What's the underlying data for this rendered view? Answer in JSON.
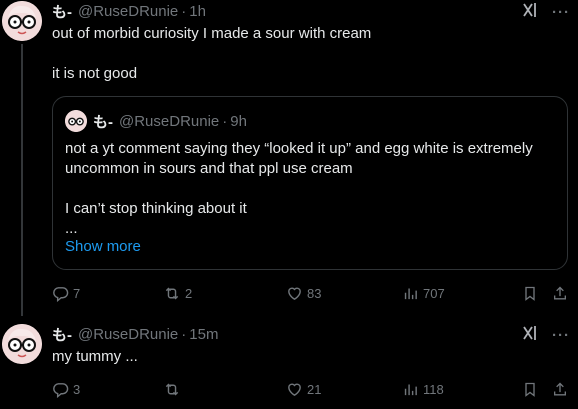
{
  "posts": [
    {
      "author_name": "も-",
      "handle": "@RuseDRunie",
      "separator": "·",
      "time": "1h",
      "text": "out of morbid curiosity I made a sour with cream\n\nit is not good",
      "quote": {
        "author_name": "も-",
        "handle": "@RuseDRunie",
        "separator": "·",
        "time": "9h",
        "text": "not a yt comment saying they “looked it up” and egg white is extremely uncommon in sours and that ppl use cream\n\nI can’t stop thinking about it\n...",
        "show_more": "Show more"
      },
      "stats": {
        "replies": "7",
        "reposts": "2",
        "likes": "83",
        "views": "707"
      }
    },
    {
      "author_name": "も-",
      "handle": "@RuseDRunie",
      "separator": "·",
      "time": "15m",
      "text": "my tummy ...",
      "stats": {
        "replies": "3",
        "reposts": "",
        "likes": "21",
        "views": "118"
      }
    }
  ],
  "icons": {
    "grok": "grok-icon",
    "more": "more-icon",
    "reply": "reply-icon",
    "repost": "repost-icon",
    "like": "like-icon",
    "views": "views-icon",
    "bookmark": "bookmark-icon",
    "share": "share-icon"
  },
  "colors": {
    "background": "#000000",
    "text": "#e7e9ea",
    "muted": "#71767b",
    "link": "#1d9bf0",
    "border": "#2f3336"
  }
}
